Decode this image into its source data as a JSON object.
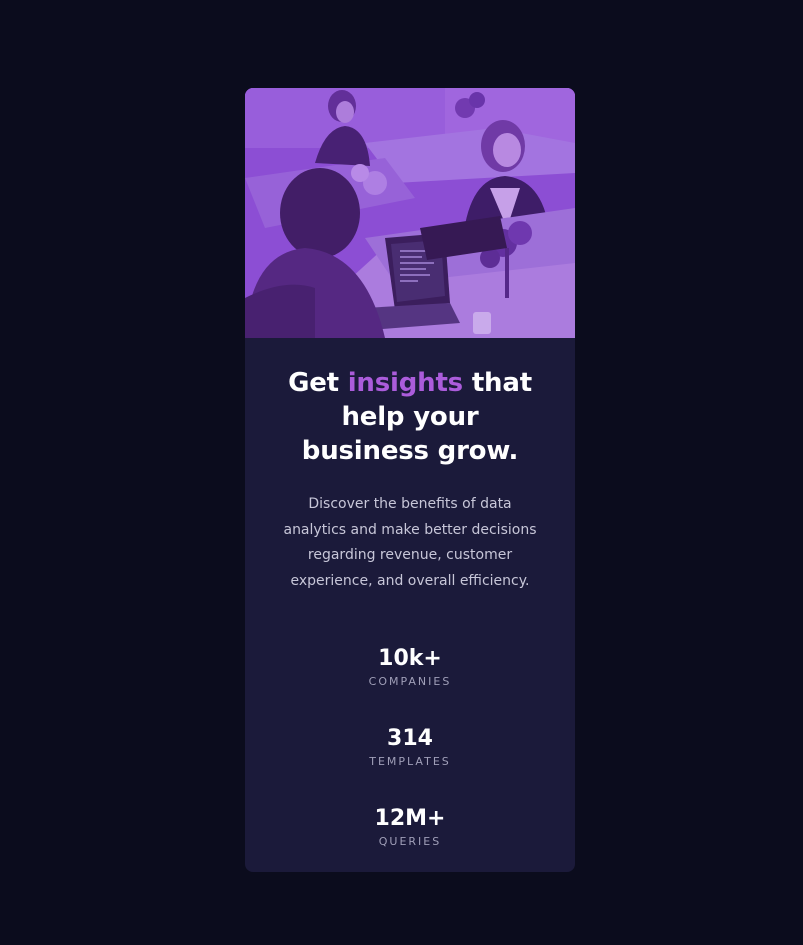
{
  "colors": {
    "page_bg": "#0b0c1d",
    "card_bg": "#1b1a3a",
    "accent": "#ab5cdb",
    "text_primary": "#ffffff",
    "text_secondary": "#c7c6d8",
    "text_muted": "#a09fb8"
  },
  "hero": {
    "image": "office-team-photo"
  },
  "headline": {
    "before": "Get ",
    "accent": "insights",
    "after": " that help your business grow."
  },
  "description": "Discover the benefits of data analytics and make better decisions regarding revenue, customer experience, and overall efficiency.",
  "stats": [
    {
      "value": "10k+",
      "label": "COMPANIES"
    },
    {
      "value": "314",
      "label": "TEMPLATES"
    },
    {
      "value": "12M+",
      "label": "QUERIES"
    }
  ]
}
